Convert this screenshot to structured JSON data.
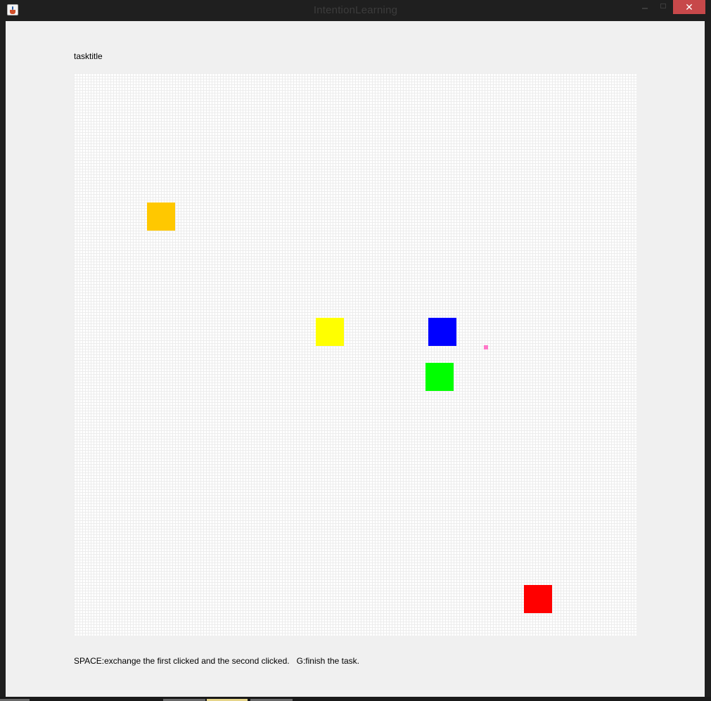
{
  "window": {
    "title": "IntentionLearning",
    "close_glyph": "✕"
  },
  "icons": {
    "app": "java-cup-icon",
    "close": "close-icon",
    "minimize": "minimize-icon",
    "maximize": "maximize-icon"
  },
  "task": {
    "title": "tasktitle",
    "instructions": "SPACE:exchange the first clicked and the second clicked.   G:finish the task."
  },
  "board": {
    "blocks": [
      {
        "name": "orange-block",
        "color": "#ffc800"
      },
      {
        "name": "yellow-block",
        "color": "#ffff00"
      },
      {
        "name": "blue-block",
        "color": "#0000ff"
      },
      {
        "name": "green-block",
        "color": "#00ff00"
      },
      {
        "name": "red-block",
        "color": "#ff0000"
      }
    ],
    "marker_color": "#ff77c8",
    "grid_color": "#ececec"
  },
  "colors": {
    "titlebar": "#1f1f1f",
    "client_background": "#f0f0f0",
    "close_button": "#c7484a"
  }
}
